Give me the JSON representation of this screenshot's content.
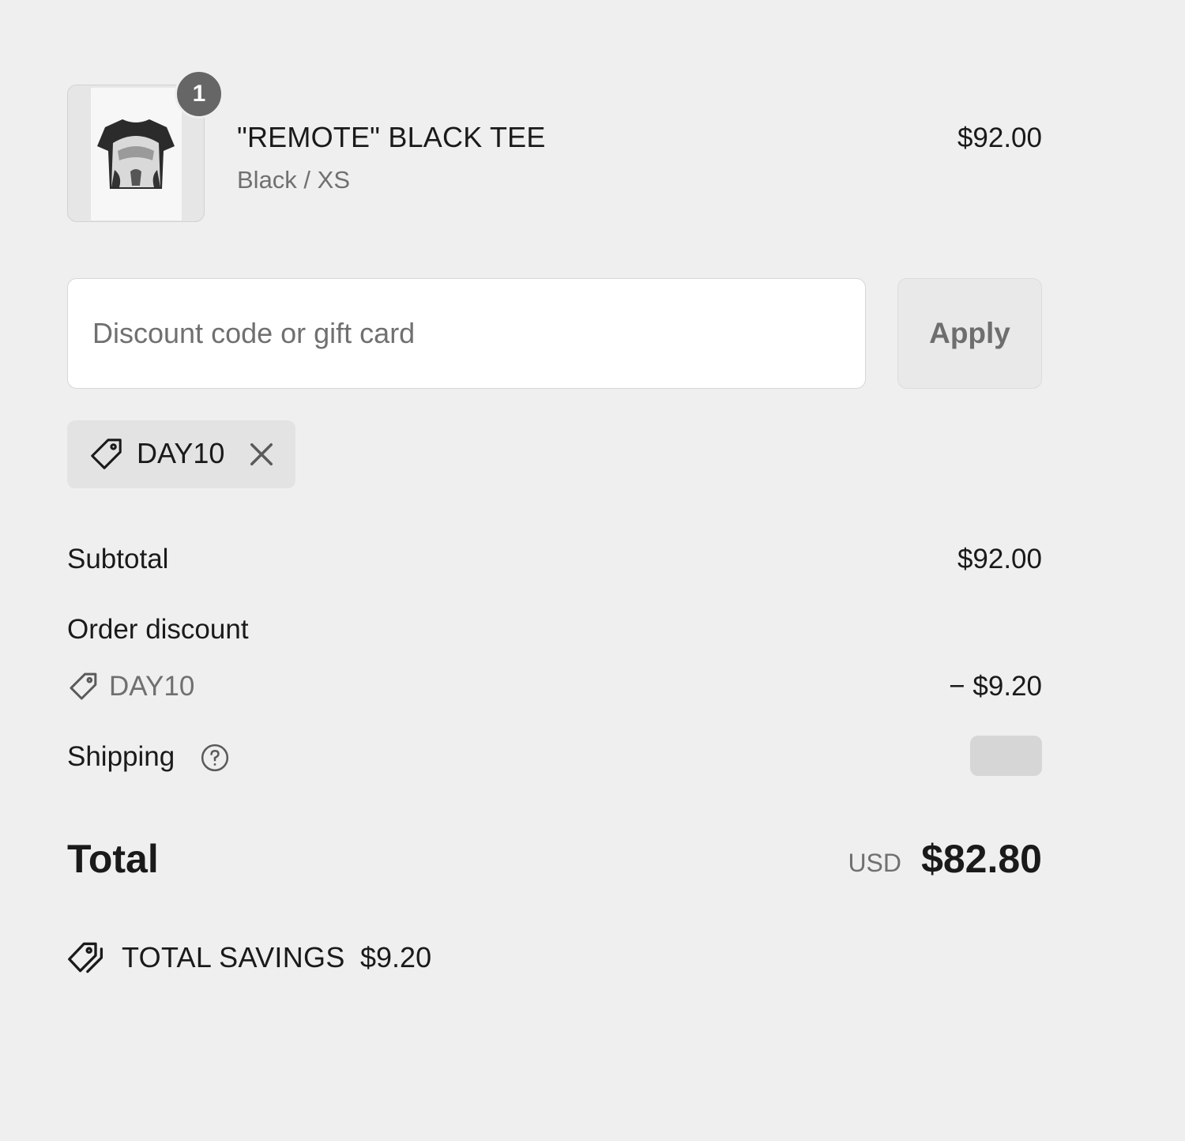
{
  "line_item": {
    "quantity": "1",
    "name": "\"REMOTE\" BLACK TEE",
    "variant": "Black / XS",
    "price": "$92.00",
    "image_icon": "tshirt-image"
  },
  "discount": {
    "placeholder": "Discount code or gift card",
    "value": "",
    "apply_label": "Apply"
  },
  "applied_code": {
    "code": "DAY10",
    "icon": "tag-icon",
    "remove_icon": "close-icon"
  },
  "totals": {
    "subtotal_label": "Subtotal",
    "subtotal_value": "$92.00",
    "order_discount_label": "Order discount",
    "discount_code": "DAY10",
    "discount_value": "− $9.20",
    "shipping_label": "Shipping",
    "total_label": "Total",
    "currency": "USD",
    "total_value": "$82.80"
  },
  "savings": {
    "label": "TOTAL SAVINGS",
    "value": "$9.20"
  },
  "colors": {
    "background": "#efefef",
    "text": "#1a1a1a",
    "muted_text": "#707070",
    "badge": "#666666"
  }
}
